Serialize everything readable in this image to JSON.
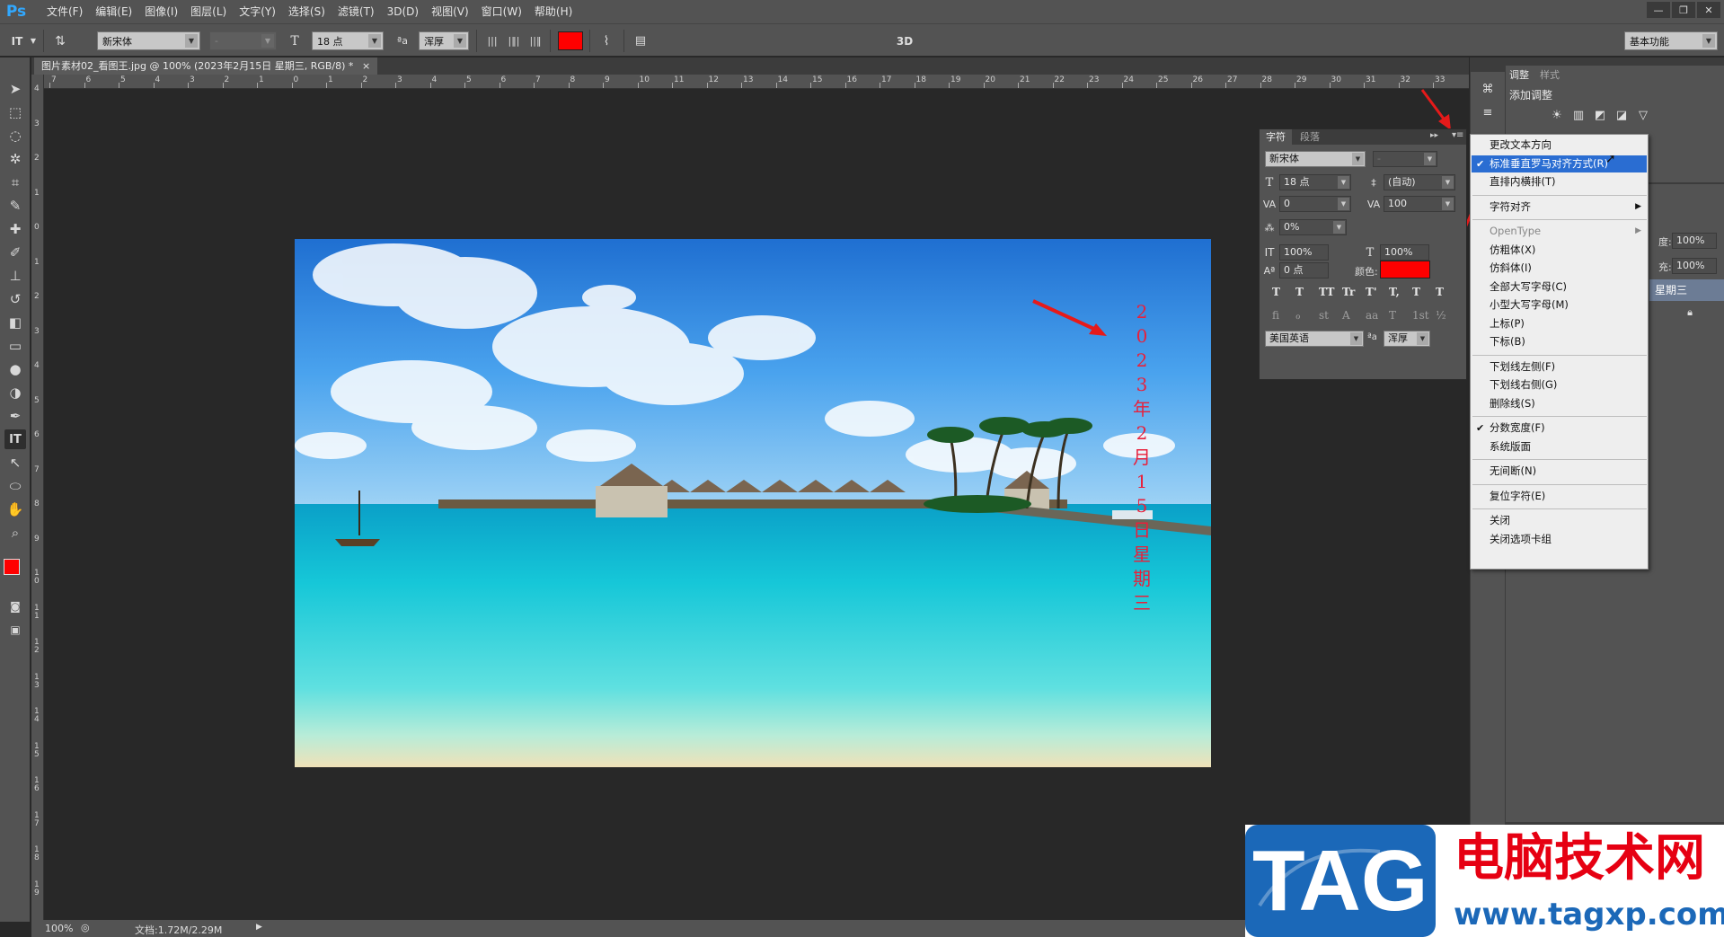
{
  "app": {
    "logo": "Ps",
    "menus": [
      "文件(F)",
      "编辑(E)",
      "图像(I)",
      "图层(L)",
      "文字(Y)",
      "选择(S)",
      "滤镜(T)",
      "3D(D)",
      "视图(V)",
      "窗口(W)",
      "帮助(H)"
    ],
    "window_controls": [
      "—",
      "❐",
      "✕"
    ]
  },
  "options_bar": {
    "tool_glyph": "IT",
    "font_family": "新宋体",
    "font_style": "-",
    "size_icon": "T",
    "font_size": "18 点",
    "aa_icon": "ªa",
    "anti_alias": "浑厚",
    "color": "#ff0000",
    "mode_3d": "3D",
    "workspace": "基本功能"
  },
  "document": {
    "tab_title": "图片素材02_看图王.jpg @ 100% (2023年2月15日 星期三, RGB/8) *",
    "close": "×",
    "vertical_text": "2023年2月15日星期三",
    "text_color": "#e8203b"
  },
  "ruler": {
    "h": [
      "7",
      "6",
      "5",
      "4",
      "3",
      "2",
      "1",
      "0",
      "1",
      "2",
      "3",
      "4",
      "5",
      "6",
      "7",
      "8",
      "9",
      "10",
      "11",
      "12",
      "13",
      "14",
      "15",
      "16",
      "17",
      "18",
      "19",
      "20",
      "21",
      "22",
      "23",
      "24",
      "25",
      "26",
      "27",
      "28",
      "29",
      "30",
      "31",
      "32",
      "33"
    ],
    "v": [
      "4",
      "3",
      "2",
      "1",
      "0",
      "1",
      "2",
      "3",
      "4",
      "5",
      "6",
      "7",
      "8",
      "9",
      "1\n0",
      "1\n1",
      "1\n2",
      "1\n3",
      "1\n4",
      "1\n5",
      "1\n6",
      "1\n7",
      "1\n8",
      "1\n9"
    ]
  },
  "status": {
    "zoom": "100%",
    "doc": "文档:1.72M/2.29M"
  },
  "char_panel": {
    "tabs": [
      "字符",
      "段落"
    ],
    "font": "新宋体",
    "style": "-",
    "size": "18 点",
    "leading": "(自动)",
    "kerning": "0",
    "tracking": "100",
    "scale_pct": "0%",
    "vscale": "100%",
    "hscale": "100%",
    "baseline": "0 点",
    "color_label": "颜色:",
    "color": "#ff0000",
    "type_buttons": [
      "T",
      "T",
      "TT",
      "Tr",
      "T'",
      "T,",
      "T",
      "T"
    ],
    "ot_buttons": [
      "fi",
      "ℴ",
      "st",
      "A",
      "aa",
      "T",
      "1st",
      "½"
    ],
    "language": "美国英语",
    "aa_icon": "ªa",
    "anti_alias": "浑厚"
  },
  "right_panels": {
    "tabs": [
      "调整",
      "样式"
    ],
    "add_adjust": "添加调整",
    "opacity_label": "度:",
    "opacity": "100%",
    "fill_label": "充:",
    "fill": "100%",
    "layer_name": "星期三"
  },
  "context_menu": {
    "items": [
      {
        "label": "更改文本方向",
        "checked": false,
        "sub": false,
        "disabled": false,
        "hl": false
      },
      {
        "label": "标准垂直罗马对齐方式(R)",
        "checked": true,
        "sub": false,
        "disabled": false,
        "hl": true
      },
      {
        "label": "直排内横排(T)",
        "checked": false,
        "sub": false,
        "disabled": false,
        "hl": false
      },
      {
        "sep": true
      },
      {
        "label": "字符对齐",
        "checked": false,
        "sub": true,
        "disabled": false,
        "hl": false
      },
      {
        "sep": true
      },
      {
        "label": "OpenType",
        "checked": false,
        "sub": true,
        "disabled": true,
        "hl": false
      },
      {
        "label": "仿粗体(X)",
        "checked": false,
        "sub": false,
        "disabled": false,
        "hl": false
      },
      {
        "label": "仿斜体(I)",
        "checked": false,
        "sub": false,
        "disabled": false,
        "hl": false
      },
      {
        "label": "全部大写字母(C)",
        "checked": false,
        "sub": false,
        "disabled": false,
        "hl": false
      },
      {
        "label": "小型大写字母(M)",
        "checked": false,
        "sub": false,
        "disabled": false,
        "hl": false
      },
      {
        "label": "上标(P)",
        "checked": false,
        "sub": false,
        "disabled": false,
        "hl": false
      },
      {
        "label": "下标(B)",
        "checked": false,
        "sub": false,
        "disabled": false,
        "hl": false
      },
      {
        "sep": true
      },
      {
        "label": "下划线左侧(F)",
        "checked": false,
        "sub": false,
        "disabled": false,
        "hl": false
      },
      {
        "label": "下划线右侧(G)",
        "checked": false,
        "sub": false,
        "disabled": false,
        "hl": false
      },
      {
        "label": "删除线(S)",
        "checked": false,
        "sub": false,
        "disabled": false,
        "hl": false
      },
      {
        "sep": true
      },
      {
        "label": "分数宽度(F)",
        "checked": true,
        "sub": false,
        "disabled": false,
        "hl": false
      },
      {
        "label": "系统版面",
        "checked": false,
        "sub": false,
        "disabled": false,
        "hl": false
      },
      {
        "sep": true
      },
      {
        "label": "无间断(N)",
        "checked": false,
        "sub": false,
        "disabled": false,
        "hl": false
      },
      {
        "sep": true
      },
      {
        "label": "复位字符(E)",
        "checked": false,
        "sub": false,
        "disabled": false,
        "hl": false
      },
      {
        "sep": true
      },
      {
        "label": "关闭",
        "checked": false,
        "sub": false,
        "disabled": false,
        "hl": false
      },
      {
        "label": "关闭选项卡组",
        "checked": false,
        "sub": false,
        "disabled": false,
        "hl": false
      }
    ]
  },
  "watermark": {
    "tag": "TAG",
    "cn": "电脑技术网",
    "url": "www.tagxp.com"
  }
}
